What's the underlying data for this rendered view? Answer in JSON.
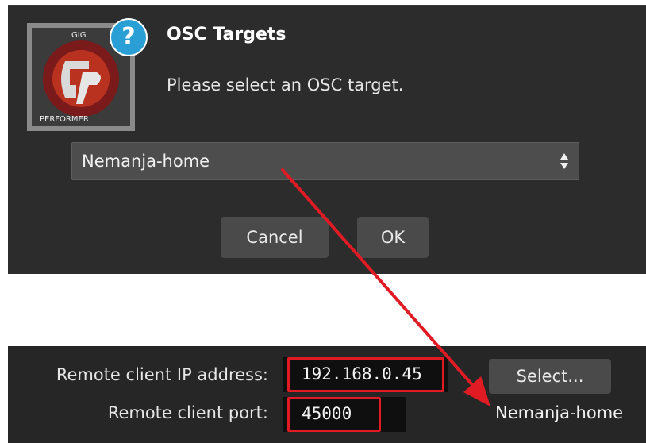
{
  "dialog": {
    "logo": {
      "top_text": "GIG",
      "bottom_text": "PERFORMER",
      "mark": "GP"
    },
    "help_icon": "question-mark-icon",
    "title": "OSC Targets",
    "message": "Please select an OSC target.",
    "select_value": "Nemanja-home",
    "select_icon": "updown-arrows-icon",
    "cancel_label": "Cancel",
    "ok_label": "OK"
  },
  "settings": {
    "ip_label": "Remote client IP address:",
    "ip_value": "192.168.0.45",
    "port_label": "Remote client port:",
    "port_value": "45000",
    "select_button_label": "Select...",
    "target_name": "Nemanja-home"
  },
  "colors": {
    "dialog_bg": "#2c2c2c",
    "panel_bg": "#262626",
    "help_badge": "#2a9fd6",
    "annotation_red": "#e01b24"
  }
}
